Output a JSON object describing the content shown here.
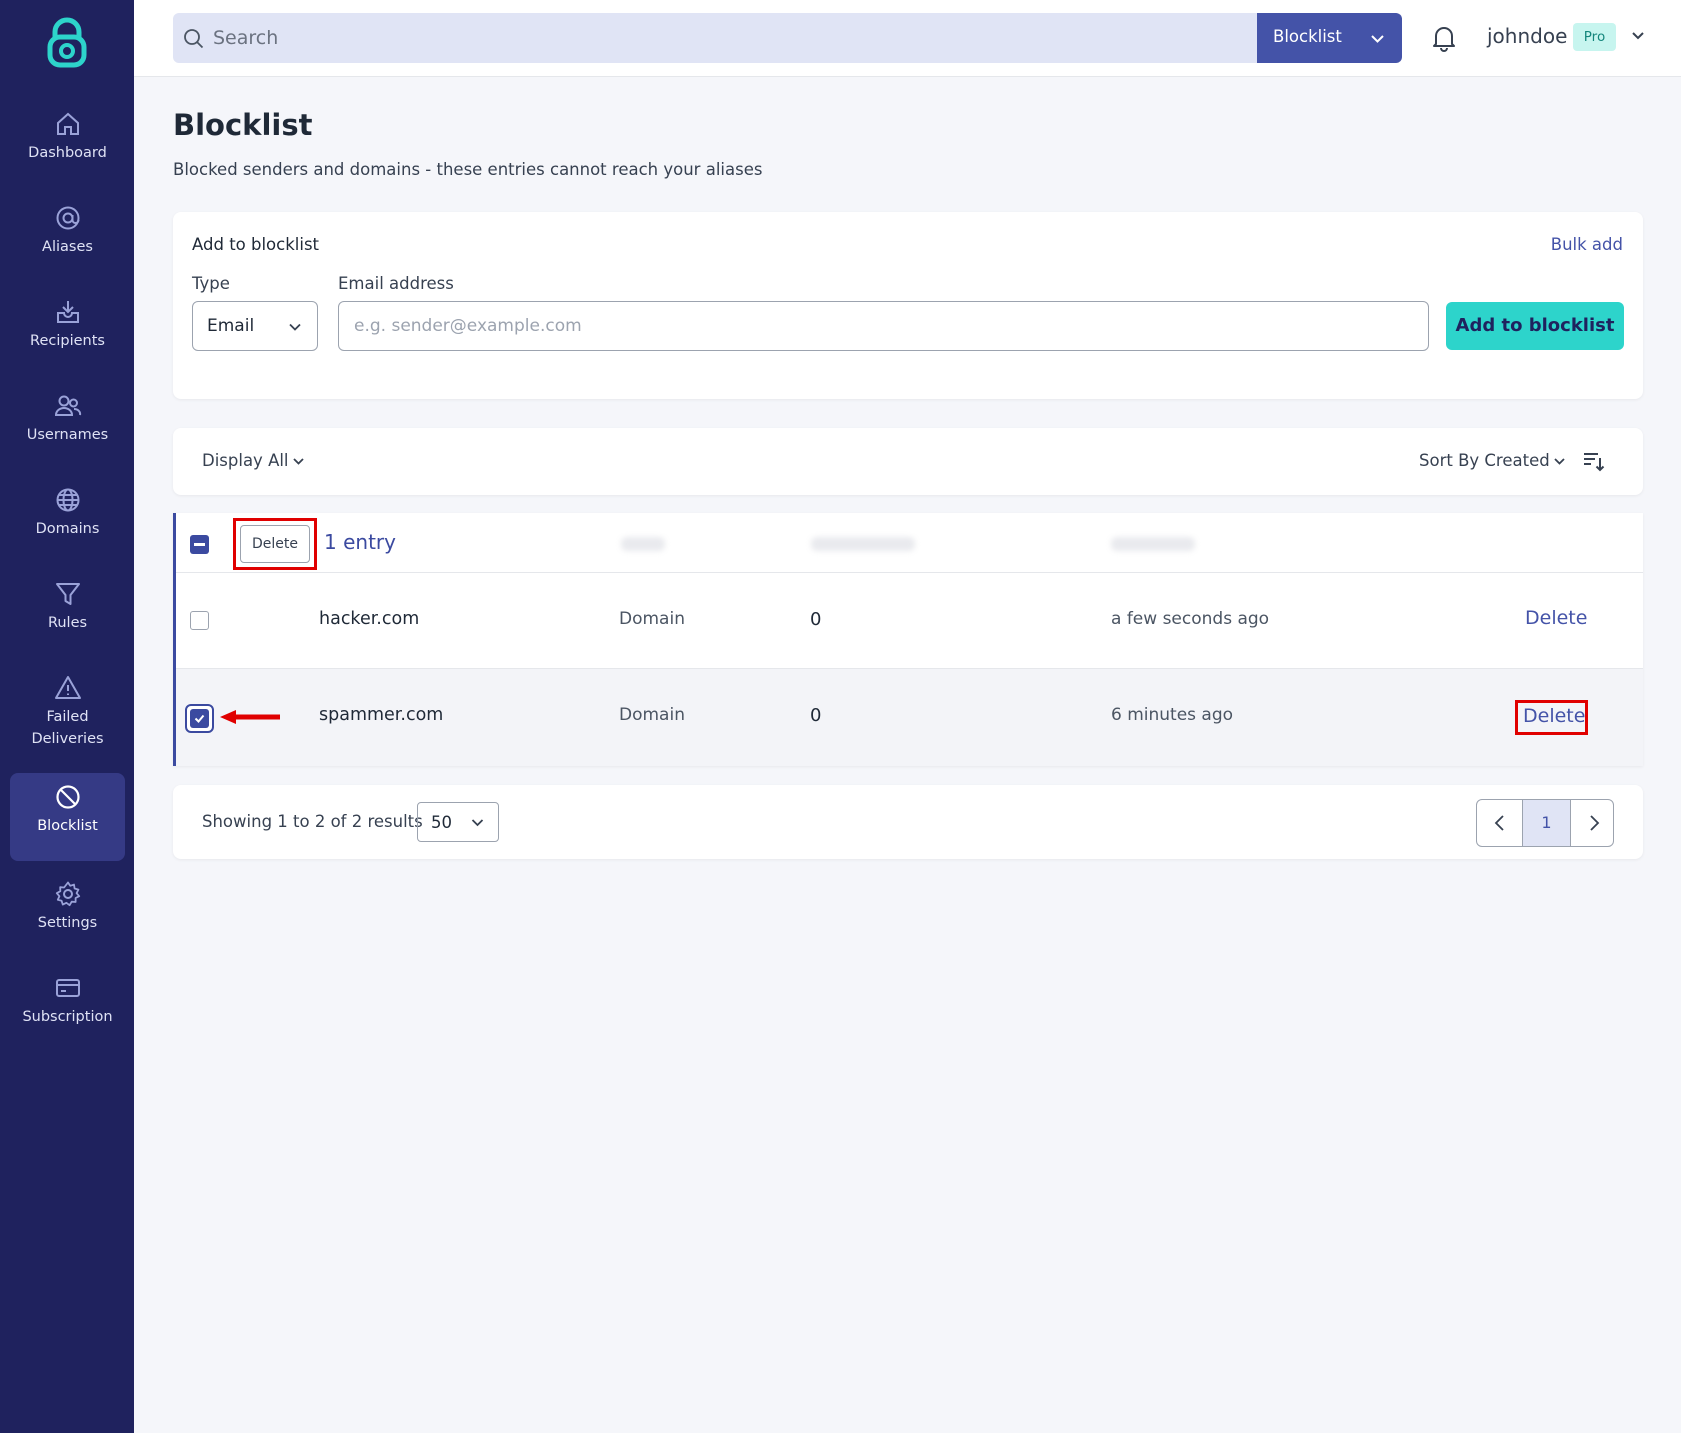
{
  "sidebar": {
    "items": [
      {
        "label": "Dashboard",
        "icon": "home-icon"
      },
      {
        "label": "Aliases",
        "icon": "at-icon"
      },
      {
        "label": "Recipients",
        "icon": "inbox-icon"
      },
      {
        "label": "Usernames",
        "icon": "users-icon"
      },
      {
        "label": "Domains",
        "icon": "globe-icon"
      },
      {
        "label": "Rules",
        "icon": "filter-icon"
      },
      {
        "label": "Failed\nDeliveries",
        "icon": "warning-icon"
      },
      {
        "label": "Blocklist",
        "icon": "block-icon",
        "active": true
      },
      {
        "label": "Settings",
        "icon": "gear-icon"
      },
      {
        "label": "Subscription",
        "icon": "credit-card-icon"
      }
    ]
  },
  "topbar": {
    "search_placeholder": "Search",
    "scope": "Blocklist",
    "username": "johndoe",
    "plan_badge": "Pro"
  },
  "page": {
    "title": "Blocklist",
    "subtitle": "Blocked senders and domains - these entries cannot reach your aliases"
  },
  "add_form": {
    "heading": "Add to blocklist",
    "bulk_add": "Bulk add",
    "type_label": "Type",
    "type_value": "Email",
    "email_label": "Email address",
    "email_placeholder": "e.g. sender@example.com",
    "submit": "Add to blocklist"
  },
  "filters": {
    "display": "Display All",
    "sort": "Sort By Created"
  },
  "table": {
    "bulk_delete": "Delete",
    "selected_count": "1 entry",
    "rows": [
      {
        "value": "hacker.com",
        "type": "Domain",
        "count": "0",
        "created": "a few seconds ago",
        "action": "Delete",
        "checked": false
      },
      {
        "value": "spammer.com",
        "type": "Domain",
        "count": "0",
        "created": "6 minutes ago",
        "action": "Delete",
        "checked": true
      }
    ]
  },
  "pagination": {
    "showing": "Showing 1 to 2 of 2 results",
    "per_page": "50",
    "current_page": "1"
  },
  "colors": {
    "sidebar_bg": "#1f225e",
    "accent": "#4453a8",
    "primary_button": "#2dd4cb",
    "highlight": "#e00000"
  }
}
